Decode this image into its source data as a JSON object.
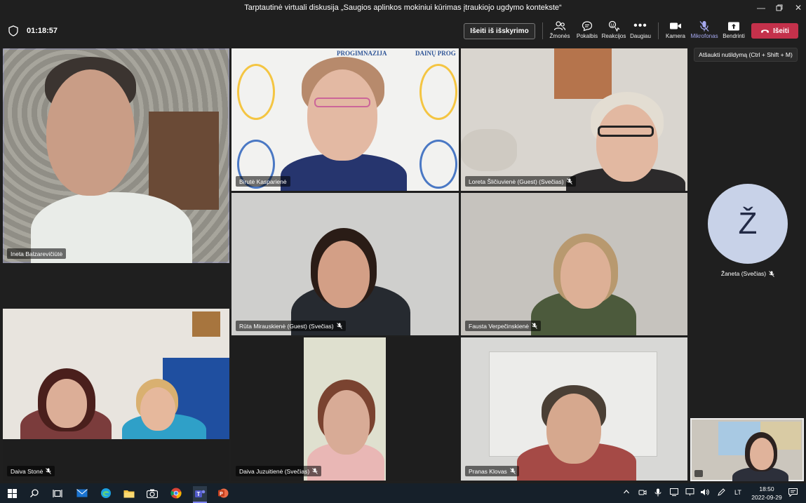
{
  "window": {
    "title": "Tarptautinė virtuali diskusija „Saugios aplinkos mokiniui kūrimas įtraukiojo ugdymo kontekste“"
  },
  "toolbar": {
    "timer": "01:18:57",
    "leave_breakout": "Išeiti iš išskyrimo",
    "people": "Žmonės",
    "chat": "Pokalbis",
    "reactions": "Reakcijos",
    "more": "Daugiau",
    "camera": "Kamera",
    "mic": "Mikrofonas",
    "share": "Bendrinti",
    "leave": "Išeiti"
  },
  "tooltip": "Atšaukti nutildymą (Ctrl + Shift + M)",
  "participants": [
    {
      "name": "Ineta Balzarevičiūtė",
      "muted": false
    },
    {
      "name": "Birutė Kasparienė",
      "muted": false
    },
    {
      "name": "Loreta Šličiuvienė (Guest) (Svečias)",
      "muted": true
    },
    {
      "name": "Rūta Mirauskienė (Guest) (Svečias)",
      "muted": true
    },
    {
      "name": "Fausta Verpečinskienė",
      "muted": true
    },
    {
      "name": "Daiva Stonė",
      "muted": true
    },
    {
      "name": "Daiva Juzuitienė (Svečias)",
      "muted": true
    },
    {
      "name": "Pranas Klovas",
      "muted": true
    }
  ],
  "avatar_participant": {
    "initial": "Ž",
    "name": "Žaneta (Svečias)"
  },
  "background_text": {
    "school_a": "PROGIMNAZIJA",
    "school_b": "DAINŲ PROG"
  },
  "taskbar": {
    "language": "LT",
    "time": "18:50",
    "date": "2022-09-29"
  },
  "colors": {
    "accent": "#7f85f5",
    "leave": "#c4314b",
    "taskbar": "#16202a"
  }
}
